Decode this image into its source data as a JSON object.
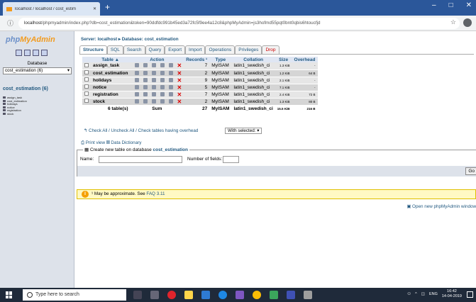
{
  "browser": {
    "tab_title": "localhost / localhost / cost_estim",
    "url_host": "localhost",
    "url_rest": "/phpmyadmin/index.php?db=cost_estimation&token=90ddfdc991b45ed3a72fc5f9ee4a12c8&phpMyAdmin=js3hofmd55pqt0bnt0qbis6htoucfjd"
  },
  "sidebar": {
    "logo_php": "php",
    "logo_myadmin": "MyAdmin",
    "db_label": "Database",
    "db_select": "cost_estimation (6)",
    "db_title": "cost_estimation (6)",
    "tables": [
      "assign_task",
      "cost_estimation",
      "holidays",
      "notice",
      "registration",
      "stock"
    ]
  },
  "breadcrumb": "Server: localhost ▸ Database: cost_estimation",
  "tabs": [
    {
      "label": "Structure",
      "active": true
    },
    {
      "label": "SQL"
    },
    {
      "label": "Search"
    },
    {
      "label": "Query"
    },
    {
      "label": "Export"
    },
    {
      "label": "Import"
    },
    {
      "label": "Operations"
    },
    {
      "label": "Privileges"
    },
    {
      "label": "Drop",
      "danger": true
    }
  ],
  "table_headers": {
    "table": "Table ▲",
    "action": "Action",
    "records": "Records ¹",
    "type": "Type",
    "collation": "Collation",
    "size": "Size",
    "overhead": "Overhead"
  },
  "rows": [
    {
      "name": "assign_task",
      "records": "7",
      "type": "MyISAM",
      "collation": "latin1_swedish_ci",
      "size": "1.3 KiB",
      "overhead": "-"
    },
    {
      "name": "cost_estimation",
      "records": "2",
      "type": "MyISAM",
      "collation": "latin1_swedish_ci",
      "size": "1.2 KiB",
      "overhead": "64 B"
    },
    {
      "name": "holidays",
      "records": "9",
      "type": "MyISAM",
      "collation": "latin1_swedish_ci",
      "size": "2.1 KiB",
      "overhead": "-"
    },
    {
      "name": "notice",
      "records": "5",
      "type": "MyISAM",
      "collation": "latin1_swedish_ci",
      "size": "7.1 KiB",
      "overhead": "-"
    },
    {
      "name": "registration",
      "records": "7",
      "type": "MyISAM",
      "collation": "latin1_swedish_ci",
      "size": "2.4 KiB",
      "overhead": "72 B"
    },
    {
      "name": "stock",
      "records": "2",
      "type": "MyISAM",
      "collation": "latin1_swedish_ci",
      "size": "1.3 KiB",
      "overhead": "80 B"
    }
  ],
  "summary": {
    "tables": "6 table(s)",
    "label": "Sum",
    "records": "27",
    "type": "MyISAM",
    "collation": "latin1_swedish_ci",
    "size": "15.5 KiB",
    "overhead": "216 B"
  },
  "check_all": "Check All / Uncheck All / Check tables having overhead",
  "with_selected": "With selected: ▾",
  "print_view": "Print view",
  "data_dictionary": "Data Dictionary",
  "create": {
    "title_prefix": "Create new table on database ",
    "db": "cost_estimation",
    "name_label": "Name:",
    "fields_label": "Number of fields:",
    "go": "Go"
  },
  "note": {
    "text": "¹ May be approximate. See ",
    "link": "FAQ 3.11"
  },
  "open_new": "Open new phpMyAdmin window",
  "taskbar": {
    "search": "Type here to search",
    "lang": "ENG",
    "time": "16:42",
    "date": "14-04-2019"
  }
}
